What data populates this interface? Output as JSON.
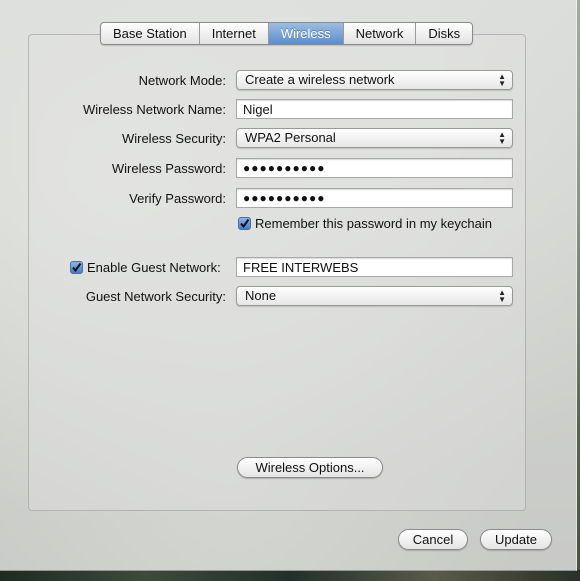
{
  "tabs": [
    {
      "label": "Base Station"
    },
    {
      "label": "Internet"
    },
    {
      "label": "Wireless"
    },
    {
      "label": "Network"
    },
    {
      "label": "Disks"
    }
  ],
  "active_tab": "Wireless",
  "form": {
    "network_mode": {
      "label": "Network Mode:",
      "value": "Create a wireless network"
    },
    "network_name": {
      "label": "Wireless Network Name:",
      "value": "Nigel"
    },
    "security": {
      "label": "Wireless Security:",
      "value": "WPA2 Personal"
    },
    "password": {
      "label": "Wireless Password:",
      "value": "●●●●●●●●●●"
    },
    "verify_password": {
      "label": "Verify Password:",
      "value": "●●●●●●●●●●"
    },
    "remember_keychain": {
      "label": "Remember this password in my keychain",
      "checked": true
    },
    "guest_network": {
      "label": "Enable Guest Network:",
      "checked": true,
      "value": "FREE INTERWEBS"
    },
    "guest_security": {
      "label": "Guest Network Security:",
      "value": "None"
    }
  },
  "buttons": {
    "wireless_options": "Wireless Options...",
    "cancel": "Cancel",
    "update": "Update"
  },
  "colors": {
    "active_tab": "#5a8ed0",
    "checkbox": "#3f7fd1"
  }
}
